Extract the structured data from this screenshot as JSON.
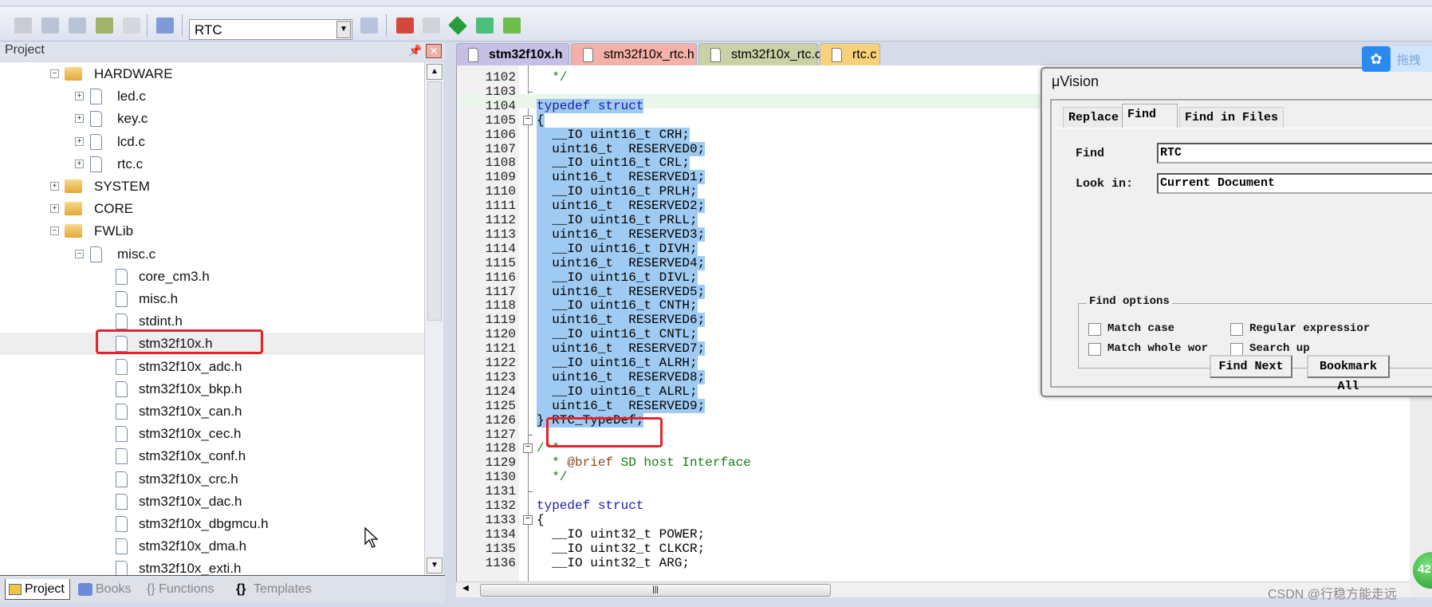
{
  "toolbar": {
    "target_combo": "RTC",
    "icons": [
      "batch-build-icon",
      "download-icon",
      "download-icon",
      "layers-icon",
      "translate-icon",
      "load-icon",
      "magic-wand-icon",
      "manage-components-icon",
      "select-packs-icon",
      "pack-installer-icon",
      "filter-icon",
      "options-icon"
    ]
  },
  "project_panel": {
    "title": "Project",
    "tree": [
      {
        "label": "HARDWARE",
        "type": "folder",
        "level": 0,
        "expander": "−"
      },
      {
        "label": "led.c",
        "type": "file",
        "level": 1,
        "expander": "+"
      },
      {
        "label": "key.c",
        "type": "file",
        "level": 1,
        "expander": "+"
      },
      {
        "label": "lcd.c",
        "type": "file",
        "level": 1,
        "expander": "+"
      },
      {
        "label": "rtc.c",
        "type": "file",
        "level": 1,
        "expander": "+"
      },
      {
        "label": "SYSTEM",
        "type": "folder",
        "level": 0,
        "expander": "+"
      },
      {
        "label": "CORE",
        "type": "folder",
        "level": 0,
        "expander": "+"
      },
      {
        "label": "FWLib",
        "type": "folder",
        "level": 0,
        "expander": "−"
      },
      {
        "label": "misc.c",
        "type": "file",
        "level": 1,
        "expander": "−"
      },
      {
        "label": "core_cm3.h",
        "type": "file",
        "level": 2
      },
      {
        "label": "misc.h",
        "type": "file",
        "level": 2
      },
      {
        "label": "stdint.h",
        "type": "file",
        "level": 2
      },
      {
        "label": "stm32f10x.h",
        "type": "file",
        "level": 2,
        "selected": true
      },
      {
        "label": "stm32f10x_adc.h",
        "type": "file",
        "level": 2
      },
      {
        "label": "stm32f10x_bkp.h",
        "type": "file",
        "level": 2
      },
      {
        "label": "stm32f10x_can.h",
        "type": "file",
        "level": 2
      },
      {
        "label": "stm32f10x_cec.h",
        "type": "file",
        "level": 2
      },
      {
        "label": "stm32f10x_conf.h",
        "type": "file",
        "level": 2
      },
      {
        "label": "stm32f10x_crc.h",
        "type": "file",
        "level": 2
      },
      {
        "label": "stm32f10x_dac.h",
        "type": "file",
        "level": 2
      },
      {
        "label": "stm32f10x_dbgmcu.h",
        "type": "file",
        "level": 2
      },
      {
        "label": "stm32f10x_dma.h",
        "type": "file",
        "level": 2
      },
      {
        "label": "stm32f10x_exti.h",
        "type": "file",
        "level": 2
      }
    ],
    "bottom_tabs": [
      "Project",
      "Books",
      "{} Functions",
      "Templates"
    ]
  },
  "editor": {
    "tabs": [
      {
        "label": "stm32f10x.h",
        "color": "#c8bfe6",
        "active": true
      },
      {
        "label": "stm32f10x_rtc.h",
        "color": "#f3b1aa"
      },
      {
        "label": "stm32f10x_rtc.c",
        "color": "#c9d2a4"
      },
      {
        "label": "rtc.c",
        "color": "#f7d27a"
      }
    ],
    "lines": [
      {
        "n": "1102",
        "t": "  */",
        "k": "cm"
      },
      {
        "n": "1103",
        "t": "",
        "f": "end"
      },
      {
        "n": "1104",
        "t": "typedef struct",
        "k": "kw",
        "s": true
      },
      {
        "n": "1105",
        "t": "{",
        "s": true,
        "f": "box"
      },
      {
        "n": "1106",
        "t": "  __IO uint16_t CRH;",
        "s": true
      },
      {
        "n": "1107",
        "t": "  uint16_t  RESERVED0;",
        "s": true
      },
      {
        "n": "1108",
        "t": "  __IO uint16_t CRL;",
        "s": true
      },
      {
        "n": "1109",
        "t": "  uint16_t  RESERVED1;",
        "s": true
      },
      {
        "n": "1110",
        "t": "  __IO uint16_t PRLH;",
        "s": true
      },
      {
        "n": "1111",
        "t": "  uint16_t  RESERVED2;",
        "s": true
      },
      {
        "n": "1112",
        "t": "  __IO uint16_t PRLL;",
        "s": true
      },
      {
        "n": "1113",
        "t": "  uint16_t  RESERVED3;",
        "s": true
      },
      {
        "n": "1114",
        "t": "  __IO uint16_t DIVH;",
        "s": true
      },
      {
        "n": "1115",
        "t": "  uint16_t  RESERVED4;",
        "s": true
      },
      {
        "n": "1116",
        "t": "  __IO uint16_t DIVL;",
        "s": true
      },
      {
        "n": "1117",
        "t": "  uint16_t  RESERVED5;",
        "s": true
      },
      {
        "n": "1118",
        "t": "  __IO uint16_t CNTH;",
        "s": true
      },
      {
        "n": "1119",
        "t": "  uint16_t  RESERVED6;",
        "s": true
      },
      {
        "n": "1120",
        "t": "  __IO uint16_t CNTL;",
        "s": true
      },
      {
        "n": "1121",
        "t": "  uint16_t  RESERVED7;",
        "s": true
      },
      {
        "n": "1122",
        "t": "  __IO uint16_t ALRH;",
        "s": true
      },
      {
        "n": "1123",
        "t": "  uint16_t  RESERVED8;",
        "s": true
      },
      {
        "n": "1124",
        "t": "  __IO uint16_t ALRL;",
        "s": true
      },
      {
        "n": "1125",
        "t": "  uint16_t  RESERVED9;",
        "s": true
      },
      {
        "n": "1126",
        "t": "} RTC_TypeDef;",
        "s": true
      },
      {
        "n": "1127",
        "t": "",
        "f": "end"
      },
      {
        "n": "1128",
        "t": "/**",
        "k": "cm",
        "f": "box"
      },
      {
        "n": "1129",
        "t": "  * @brief SD host Interface",
        "k": "cm"
      },
      {
        "n": "1130",
        "t": "  */",
        "k": "cm"
      },
      {
        "n": "1131",
        "t": "",
        "f": "end"
      },
      {
        "n": "1132",
        "t": "typedef struct",
        "k": "kw"
      },
      {
        "n": "1133",
        "t": "{",
        "f": "box"
      },
      {
        "n": "1134",
        "t": "  __IO uint32_t POWER;"
      },
      {
        "n": "1135",
        "t": "  __IO uint32_t CLKCR;"
      },
      {
        "n": "1136",
        "t": "  __IO uint32_t ARG;"
      }
    ]
  },
  "find_dialog": {
    "title": "μVision",
    "tabs": [
      "Replace",
      "Find",
      "Find in Files"
    ],
    "active_tab": "Find",
    "find_label": "Find",
    "find_value": "RTC",
    "lookin_label": "Look in:",
    "lookin_value": "Current Document",
    "options_title": "Find options",
    "options": [
      {
        "label": "Match case",
        "checked": false
      },
      {
        "label": "Regular expressior",
        "checked": false
      },
      {
        "label": "Match whole wor",
        "checked": false
      },
      {
        "label": "Search up",
        "checked": false
      }
    ],
    "find_next": "Find Next",
    "bookmark_all": "Bookmark All"
  },
  "overlay": {
    "baidu_label": "拖拽",
    "badge": "42",
    "watermark": "CSDN @行稳方能走远",
    "highlight_color": "#e8222a"
  }
}
